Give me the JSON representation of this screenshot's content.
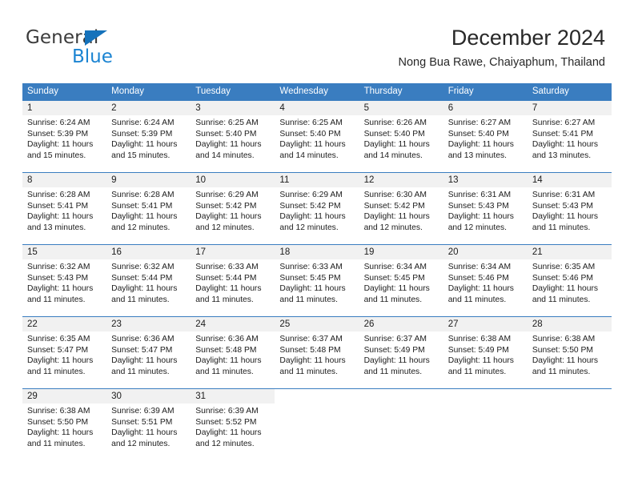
{
  "brand": {
    "name_top": "General",
    "name_bottom": "Blue",
    "triangle_color": "#1572bb",
    "blue_color": "#1b84d2"
  },
  "header": {
    "title": "December 2024",
    "subtitle": "Nong Bua Rawe, Chaiyaphum, Thailand"
  },
  "theme": {
    "header_band": "#3a7dc0",
    "day_number_band": "#f1f1f1",
    "text": "#1c1c1c"
  },
  "weekdays": [
    "Sunday",
    "Monday",
    "Tuesday",
    "Wednesday",
    "Thursday",
    "Friday",
    "Saturday"
  ],
  "weeks": [
    [
      {
        "day": "1",
        "sunrise": "Sunrise: 6:24 AM",
        "sunset": "Sunset: 5:39 PM",
        "daylight_line1": "Daylight: 11 hours",
        "daylight_line2": "and 15 minutes."
      },
      {
        "day": "2",
        "sunrise": "Sunrise: 6:24 AM",
        "sunset": "Sunset: 5:39 PM",
        "daylight_line1": "Daylight: 11 hours",
        "daylight_line2": "and 15 minutes."
      },
      {
        "day": "3",
        "sunrise": "Sunrise: 6:25 AM",
        "sunset": "Sunset: 5:40 PM",
        "daylight_line1": "Daylight: 11 hours",
        "daylight_line2": "and 14 minutes."
      },
      {
        "day": "4",
        "sunrise": "Sunrise: 6:25 AM",
        "sunset": "Sunset: 5:40 PM",
        "daylight_line1": "Daylight: 11 hours",
        "daylight_line2": "and 14 minutes."
      },
      {
        "day": "5",
        "sunrise": "Sunrise: 6:26 AM",
        "sunset": "Sunset: 5:40 PM",
        "daylight_line1": "Daylight: 11 hours",
        "daylight_line2": "and 14 minutes."
      },
      {
        "day": "6",
        "sunrise": "Sunrise: 6:27 AM",
        "sunset": "Sunset: 5:40 PM",
        "daylight_line1": "Daylight: 11 hours",
        "daylight_line2": "and 13 minutes."
      },
      {
        "day": "7",
        "sunrise": "Sunrise: 6:27 AM",
        "sunset": "Sunset: 5:41 PM",
        "daylight_line1": "Daylight: 11 hours",
        "daylight_line2": "and 13 minutes."
      }
    ],
    [
      {
        "day": "8",
        "sunrise": "Sunrise: 6:28 AM",
        "sunset": "Sunset: 5:41 PM",
        "daylight_line1": "Daylight: 11 hours",
        "daylight_line2": "and 13 minutes."
      },
      {
        "day": "9",
        "sunrise": "Sunrise: 6:28 AM",
        "sunset": "Sunset: 5:41 PM",
        "daylight_line1": "Daylight: 11 hours",
        "daylight_line2": "and 12 minutes."
      },
      {
        "day": "10",
        "sunrise": "Sunrise: 6:29 AM",
        "sunset": "Sunset: 5:42 PM",
        "daylight_line1": "Daylight: 11 hours",
        "daylight_line2": "and 12 minutes."
      },
      {
        "day": "11",
        "sunrise": "Sunrise: 6:29 AM",
        "sunset": "Sunset: 5:42 PM",
        "daylight_line1": "Daylight: 11 hours",
        "daylight_line2": "and 12 minutes."
      },
      {
        "day": "12",
        "sunrise": "Sunrise: 6:30 AM",
        "sunset": "Sunset: 5:42 PM",
        "daylight_line1": "Daylight: 11 hours",
        "daylight_line2": "and 12 minutes."
      },
      {
        "day": "13",
        "sunrise": "Sunrise: 6:31 AM",
        "sunset": "Sunset: 5:43 PM",
        "daylight_line1": "Daylight: 11 hours",
        "daylight_line2": "and 12 minutes."
      },
      {
        "day": "14",
        "sunrise": "Sunrise: 6:31 AM",
        "sunset": "Sunset: 5:43 PM",
        "daylight_line1": "Daylight: 11 hours",
        "daylight_line2": "and 11 minutes."
      }
    ],
    [
      {
        "day": "15",
        "sunrise": "Sunrise: 6:32 AM",
        "sunset": "Sunset: 5:43 PM",
        "daylight_line1": "Daylight: 11 hours",
        "daylight_line2": "and 11 minutes."
      },
      {
        "day": "16",
        "sunrise": "Sunrise: 6:32 AM",
        "sunset": "Sunset: 5:44 PM",
        "daylight_line1": "Daylight: 11 hours",
        "daylight_line2": "and 11 minutes."
      },
      {
        "day": "17",
        "sunrise": "Sunrise: 6:33 AM",
        "sunset": "Sunset: 5:44 PM",
        "daylight_line1": "Daylight: 11 hours",
        "daylight_line2": "and 11 minutes."
      },
      {
        "day": "18",
        "sunrise": "Sunrise: 6:33 AM",
        "sunset": "Sunset: 5:45 PM",
        "daylight_line1": "Daylight: 11 hours",
        "daylight_line2": "and 11 minutes."
      },
      {
        "day": "19",
        "sunrise": "Sunrise: 6:34 AM",
        "sunset": "Sunset: 5:45 PM",
        "daylight_line1": "Daylight: 11 hours",
        "daylight_line2": "and 11 minutes."
      },
      {
        "day": "20",
        "sunrise": "Sunrise: 6:34 AM",
        "sunset": "Sunset: 5:46 PM",
        "daylight_line1": "Daylight: 11 hours",
        "daylight_line2": "and 11 minutes."
      },
      {
        "day": "21",
        "sunrise": "Sunrise: 6:35 AM",
        "sunset": "Sunset: 5:46 PM",
        "daylight_line1": "Daylight: 11 hours",
        "daylight_line2": "and 11 minutes."
      }
    ],
    [
      {
        "day": "22",
        "sunrise": "Sunrise: 6:35 AM",
        "sunset": "Sunset: 5:47 PM",
        "daylight_line1": "Daylight: 11 hours",
        "daylight_line2": "and 11 minutes."
      },
      {
        "day": "23",
        "sunrise": "Sunrise: 6:36 AM",
        "sunset": "Sunset: 5:47 PM",
        "daylight_line1": "Daylight: 11 hours",
        "daylight_line2": "and 11 minutes."
      },
      {
        "day": "24",
        "sunrise": "Sunrise: 6:36 AM",
        "sunset": "Sunset: 5:48 PM",
        "daylight_line1": "Daylight: 11 hours",
        "daylight_line2": "and 11 minutes."
      },
      {
        "day": "25",
        "sunrise": "Sunrise: 6:37 AM",
        "sunset": "Sunset: 5:48 PM",
        "daylight_line1": "Daylight: 11 hours",
        "daylight_line2": "and 11 minutes."
      },
      {
        "day": "26",
        "sunrise": "Sunrise: 6:37 AM",
        "sunset": "Sunset: 5:49 PM",
        "daylight_line1": "Daylight: 11 hours",
        "daylight_line2": "and 11 minutes."
      },
      {
        "day": "27",
        "sunrise": "Sunrise: 6:38 AM",
        "sunset": "Sunset: 5:49 PM",
        "daylight_line1": "Daylight: 11 hours",
        "daylight_line2": "and 11 minutes."
      },
      {
        "day": "28",
        "sunrise": "Sunrise: 6:38 AM",
        "sunset": "Sunset: 5:50 PM",
        "daylight_line1": "Daylight: 11 hours",
        "daylight_line2": "and 11 minutes."
      }
    ],
    [
      {
        "day": "29",
        "sunrise": "Sunrise: 6:38 AM",
        "sunset": "Sunset: 5:50 PM",
        "daylight_line1": "Daylight: 11 hours",
        "daylight_line2": "and 11 minutes."
      },
      {
        "day": "30",
        "sunrise": "Sunrise: 6:39 AM",
        "sunset": "Sunset: 5:51 PM",
        "daylight_line1": "Daylight: 11 hours",
        "daylight_line2": "and 12 minutes."
      },
      {
        "day": "31",
        "sunrise": "Sunrise: 6:39 AM",
        "sunset": "Sunset: 5:52 PM",
        "daylight_line1": "Daylight: 11 hours",
        "daylight_line2": "and 12 minutes."
      },
      {
        "day": "",
        "sunrise": "",
        "sunset": "",
        "daylight_line1": "",
        "daylight_line2": ""
      },
      {
        "day": "",
        "sunrise": "",
        "sunset": "",
        "daylight_line1": "",
        "daylight_line2": ""
      },
      {
        "day": "",
        "sunrise": "",
        "sunset": "",
        "daylight_line1": "",
        "daylight_line2": ""
      },
      {
        "day": "",
        "sunrise": "",
        "sunset": "",
        "daylight_line1": "",
        "daylight_line2": ""
      }
    ]
  ]
}
